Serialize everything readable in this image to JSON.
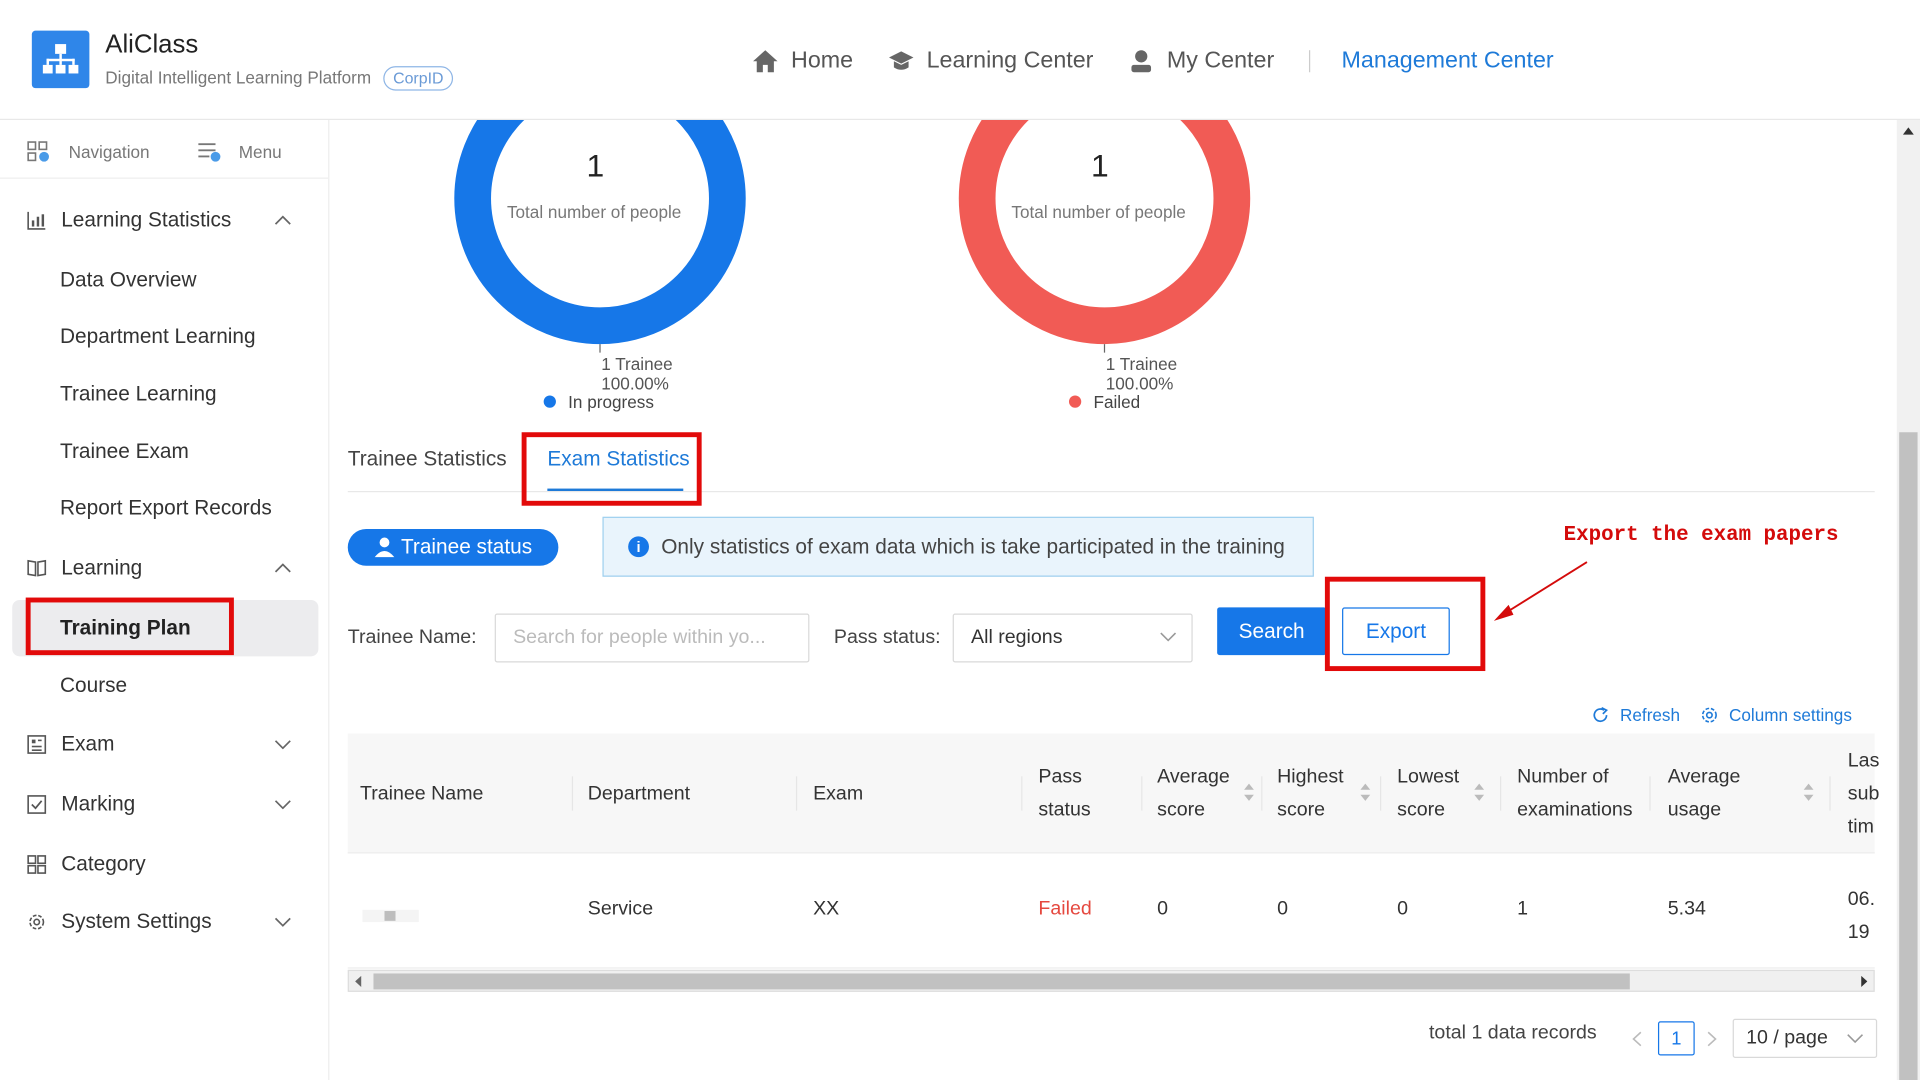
{
  "app": {
    "title": "AliClass",
    "subtitle": "Digital Intelligent Learning Platform",
    "corp_badge": "CorpID"
  },
  "topnav": [
    {
      "label": "Home",
      "icon": "home-icon"
    },
    {
      "label": "Learning Center",
      "icon": "graduation-cap-icon"
    },
    {
      "label": "My Center",
      "icon": "user-icon"
    },
    {
      "label": "Management Center",
      "icon": "",
      "active": true
    }
  ],
  "sidebar": {
    "navigation_label": "Navigation",
    "menu_label": "Menu",
    "groups": [
      {
        "label": "Learning Statistics",
        "icon": "bar-chart-icon",
        "expanded": true,
        "items": [
          "Data Overview",
          "Department Learning",
          "Trainee Learning",
          "Trainee Exam",
          "Report Export Records"
        ]
      },
      {
        "label": "Learning",
        "icon": "book-icon",
        "expanded": true,
        "items": [
          "Training Plan",
          "Course"
        ],
        "active_item": "Training Plan"
      },
      {
        "label": "Exam",
        "icon": "exam-icon",
        "expanded": false
      },
      {
        "label": "Marking",
        "icon": "marking-icon",
        "expanded": false
      },
      {
        "label": "Category",
        "icon": "category-icon",
        "expanded": false
      },
      {
        "label": "System Settings",
        "icon": "settings-icon",
        "expanded": false
      }
    ]
  },
  "donuts": [
    {
      "value": "1",
      "label": "Total number of people",
      "slice_count": "1 Trainee",
      "slice_pct": "100.00%",
      "legend": "In progress",
      "color": "#1677e8"
    },
    {
      "value": "1",
      "label": "Total number of people",
      "slice_count": "1 Trainee",
      "slice_pct": "100.00%",
      "legend": "Failed",
      "color": "#f15b55"
    }
  ],
  "tabs": [
    {
      "label": "Trainee Statistics",
      "active": false
    },
    {
      "label": "Exam Statistics",
      "active": true
    }
  ],
  "trainee_status_button": "Trainee status",
  "info_message": "Only statistics of exam data which is take participated in the training",
  "annotation": "Export the exam papers",
  "filters": {
    "trainee_name_label": "Trainee Name",
    "trainee_name_placeholder": "Search for people within yo...",
    "pass_status_label": "Pass status",
    "pass_status_value": "All regions",
    "search_button": "Search",
    "export_button": "Export"
  },
  "table_tools": {
    "refresh": "Refresh",
    "column_settings": "Column settings"
  },
  "table": {
    "headers": [
      {
        "line1": "Trainee Name",
        "line2": ""
      },
      {
        "line1": "Department",
        "line2": ""
      },
      {
        "line1": "Exam",
        "line2": ""
      },
      {
        "line1": "Pass",
        "line2": "status"
      },
      {
        "line1": "Average",
        "line2": "score"
      },
      {
        "line1": "Highest",
        "line2": "score"
      },
      {
        "line1": "Lowest",
        "line2": "score"
      },
      {
        "line1": "Number of",
        "line2": "examinations"
      },
      {
        "line1": "Average",
        "line2": "usage"
      },
      {
        "line1": "Las",
        "line2": "sub",
        "line3": "tim"
      }
    ],
    "rows": [
      {
        "trainee_name": "",
        "department": "Service",
        "exam": "XX",
        "pass_status": "Failed",
        "average_score": "0",
        "highest_score": "0",
        "lowest_score": "0",
        "examinations": "1",
        "average_usage": "5.34",
        "last_submit_1": "06.",
        "last_submit_2": "19"
      }
    ]
  },
  "pagination": {
    "total_text": "total 1 data records",
    "current_page": "1",
    "page_size": "10 / page"
  }
}
